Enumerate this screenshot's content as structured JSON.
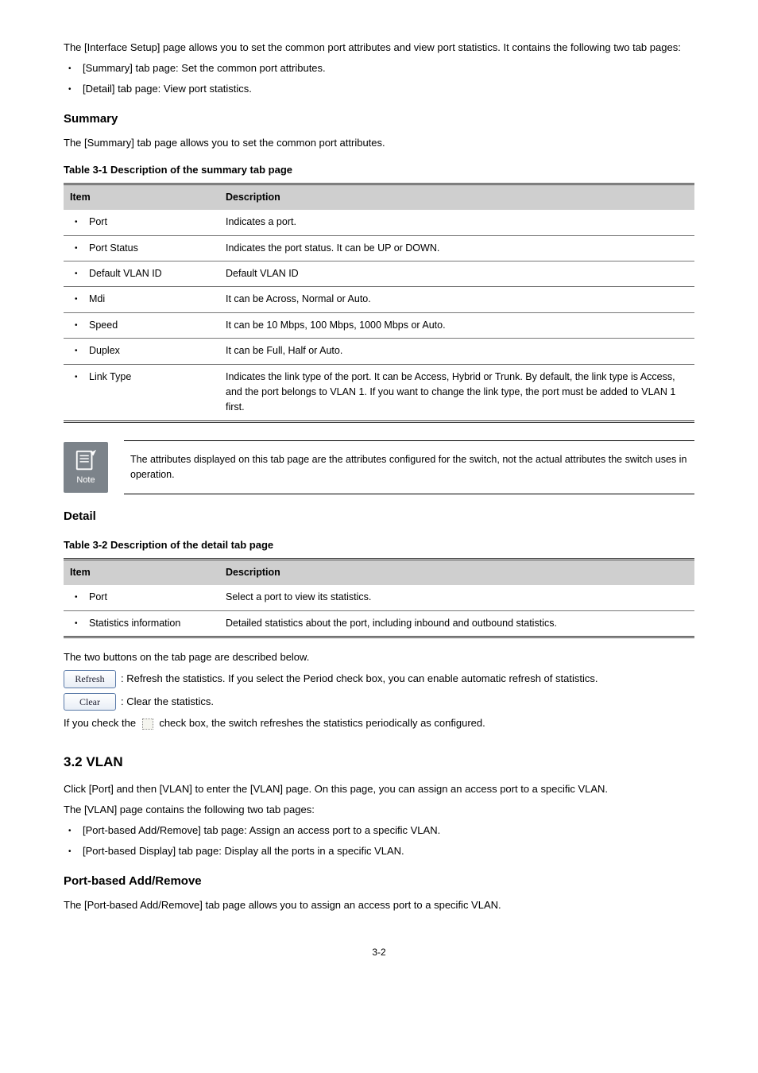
{
  "intro": {
    "p1": "The [Interface Setup] page allows you to set the common port attributes and view port statistics. It contains the following two tab pages:",
    "li1": "[Summary] tab page: Set the common port attributes.",
    "li2": "[Detail] tab page: View port statistics."
  },
  "summary": {
    "heading": "Summary",
    "p1": "The [Summary] tab page allows you to set the common port attributes.",
    "tableCaption": "Table 3-1 Description of the summary tab page",
    "th1": "Item",
    "th2": "Description",
    "r1_item": "Port",
    "r1_desc": "Indicates a port.",
    "r2_item": "Port Status",
    "r2_desc": "Indicates the port status. It can be UP or DOWN.",
    "r3_item": "Default VLAN ID",
    "r3_desc": "Default VLAN ID",
    "r4_item": "Mdi",
    "r4_desc": "It can be Across, Normal or Auto.",
    "r5_item": "Speed",
    "r5_desc": "It can be 10 Mbps, 100 Mbps, 1000 Mbps or Auto.",
    "r6_item": "Duplex",
    "r6_desc": "It can be Full, Half or Auto.",
    "r7_item": "Link Type",
    "r7_desc": "Indicates the link type of the port. It can be Access, Hybrid or Trunk. By default, the link type is Access, and the port belongs to VLAN 1. If you want to change the link type, the port must be added to VLAN 1 first."
  },
  "note": {
    "label": "Note",
    "text": "The attributes displayed on this tab page are the attributes configured for the switch, not the actual attributes the switch uses in operation."
  },
  "detail": {
    "heading": "Detail",
    "tableCaption": "Table 3-2 Description of the detail tab page",
    "th1": "Item",
    "th2": "Description",
    "r1_item": "Port",
    "r1_desc": "Select a port to view its statistics.",
    "r2_item": "Statistics information",
    "r2_desc": "Detailed statistics about the port, including inbound and outbound statistics."
  },
  "buttons": {
    "desc": "The two buttons on the tab page are described below.",
    "refresh_label": "Refresh",
    "refresh_desc": ": Refresh the statistics. If you select the Period check box, you can enable automatic refresh of statistics.",
    "clear_label": "Clear",
    "clear_desc": ": Clear the statistics.",
    "period_desc_pre": "If you check the",
    "period_desc_post": " check box, the switch refreshes the statistics periodically as configured."
  },
  "vlan": {
    "heading": "3.2  VLAN",
    "p1": "Click [Port] and then [VLAN] to enter the [VLAN] page. On this page, you can assign an access port to a specific VLAN.",
    "p2": "The [VLAN] page contains the following two tab pages:",
    "li1": "[Port-based Add/Remove] tab page: Assign an access port to a specific VLAN.",
    "li2": "[Port-based Display] tab page: Display all the ports in a specific VLAN.",
    "sub": "Port-based Add/Remove",
    "subp": "The [Port-based Add/Remove] tab page allows you to assign an access port to a specific VLAN."
  },
  "pageNumber": "3-2"
}
